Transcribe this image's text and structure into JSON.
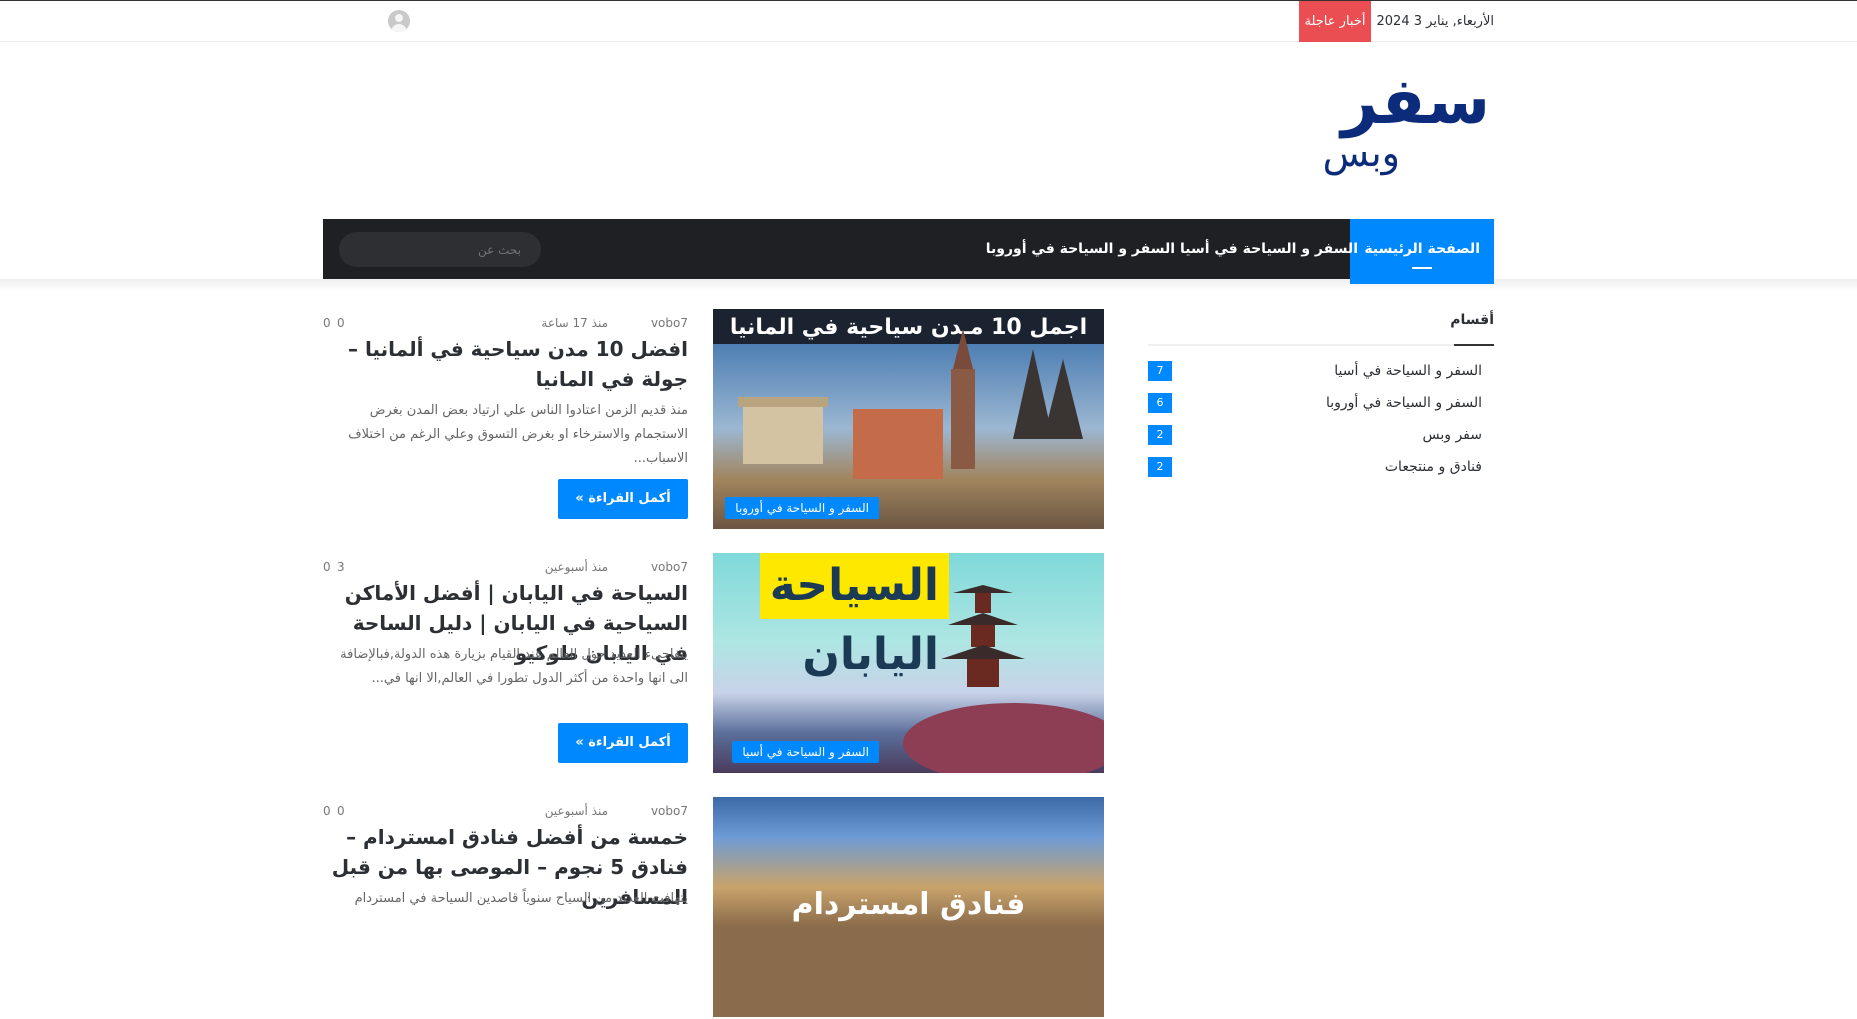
{
  "topbar": {
    "date": "الأربعاء, يناير 3 2024",
    "breaking_label": "أخبار عاجلة"
  },
  "logo": {
    "big": "سفر",
    "small": "وبس"
  },
  "nav": {
    "items": [
      "الصفحة الرئيسية",
      "السفر و السياحة في أسيا",
      "السفر و السياحة في أوروبا"
    ],
    "search_placeholder": "بحث عن"
  },
  "sidebar": {
    "title": "أقسام",
    "categories": [
      {
        "name": "السفر و السياحة في أسيا",
        "count": "7"
      },
      {
        "name": "السفر و السياحة في أوروبا",
        "count": "6"
      },
      {
        "name": "سفر وبس",
        "count": "2"
      },
      {
        "name": "فنادق و منتجعات",
        "count": "2"
      }
    ]
  },
  "posts": [
    {
      "author": "vobo7",
      "time": "منذ 17 ساعة",
      "views": "0",
      "comments": "0",
      "title": "افضل 10 مدن سياحية في ألمانيا – جولة في المانيا",
      "excerpt": "منذ قديم الزمن اعتادوا الناس علي ارتياد بعض المدن بغرض الاستجمام والاسترخاء او بغرض التسوق وعلي الرغم من اختلاف الاسباب...",
      "category": "السفر و السياحة في أوروبا",
      "thumb_text": "اجمل 10 مـدن سياحية في المانيا",
      "more": "أكمل القراءة »"
    },
    {
      "author": "vobo7",
      "time": "منذ أسبوعين",
      "views": "3",
      "comments": "0",
      "title": "السياحة في اليابان | أفضل الأماكن السياحية في اليابان | دليل الساحة في اليابان طوكيو",
      "excerpt": "يتفاجىء العديد حول العالم عند القيام بزيارة هذه الدولة,فبالإضافة الى انها واحدة من أكثر الدول تطورا في العالم,الا انها في...",
      "category": "السفر و السياحة في أسيا",
      "thumb_text_1": "السياحة",
      "thumb_text_2": "اليابان",
      "more": "أكمل القراءة »"
    },
    {
      "author": "vobo7",
      "time": "منذ أسبوعين",
      "views": "0",
      "comments": "0",
      "title": "خمسة من أفضل فنادق امستردام – فنادق 5 نجوم – الموصى بها من قبل المسافرين",
      "excerpt": "يتهافت العديد من السياح سنوياً قاصدين السياحة في امستردام",
      "thumb_text": "فنادق امستردام"
    }
  ],
  "colors": {
    "accent": "#0088ff",
    "breaking": "#ea4d52",
    "nav_bg": "#1f2024",
    "logo": "#0c2b7a"
  }
}
